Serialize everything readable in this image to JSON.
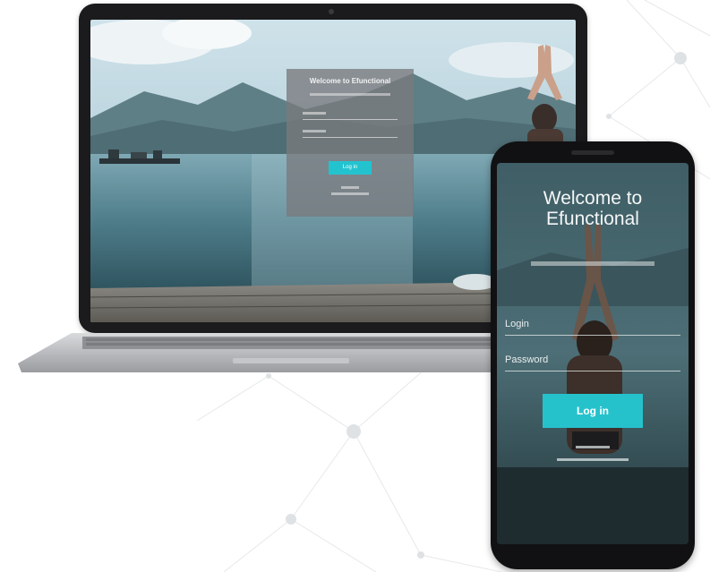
{
  "laptop": {
    "login_card": {
      "title": "Welcome to Efunctional",
      "login_button": "Log in"
    }
  },
  "phone": {
    "title_line1": "Welcome to",
    "title_line2": "Efunctional",
    "username_label": "Login",
    "password_label": "Password",
    "login_button": "Log in"
  },
  "colors": {
    "accent": "#26c2cc",
    "device_frame": "#1b1b1d",
    "card": "#7a7c80"
  }
}
